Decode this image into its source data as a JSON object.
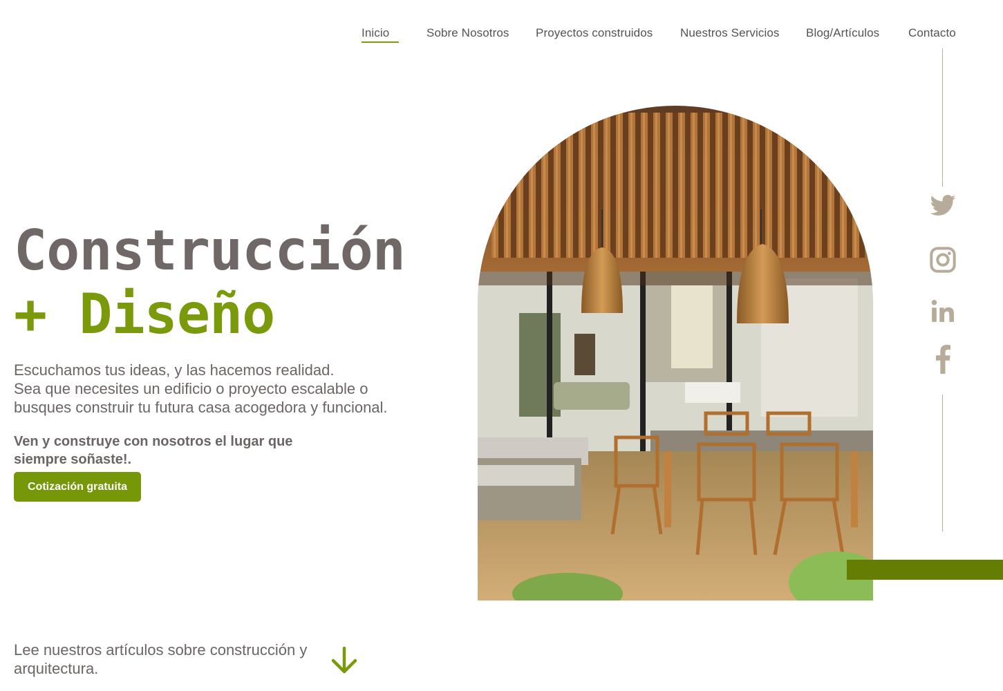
{
  "nav": {
    "items": [
      {
        "label": "Inicio",
        "active": true
      },
      {
        "label": "Sobre Nosotros"
      },
      {
        "label": "Proyectos construidos"
      },
      {
        "label": "Nuestros Servicios"
      },
      {
        "label": "Blog/Artículos"
      },
      {
        "label": "Contacto"
      }
    ]
  },
  "hero": {
    "title_line1": "Construcción",
    "title_line2": "+ Diseño",
    "description": [
      "Escuchamos tus ideas, y las hacemos realidad.",
      "Sea que necesites un edificio o proyecto escalable o",
      "busques construir tu futura casa acogedora y funcional."
    ],
    "cta_text": "Ven y construye con nosotros el lugar que siempre soñaste!.",
    "cta_button": "Cotización gratuita"
  },
  "social": {
    "icons": [
      "twitter-icon",
      "instagram-icon",
      "linkedin-icon",
      "facebook-icon"
    ]
  },
  "footer": {
    "articles_text": "Lee nuestros artículos sobre construcción y arquitectura."
  },
  "colors": {
    "accent": "#7a9a0b",
    "dark_accent": "#667d04",
    "text": "#706866",
    "social": "#b7ab99"
  }
}
